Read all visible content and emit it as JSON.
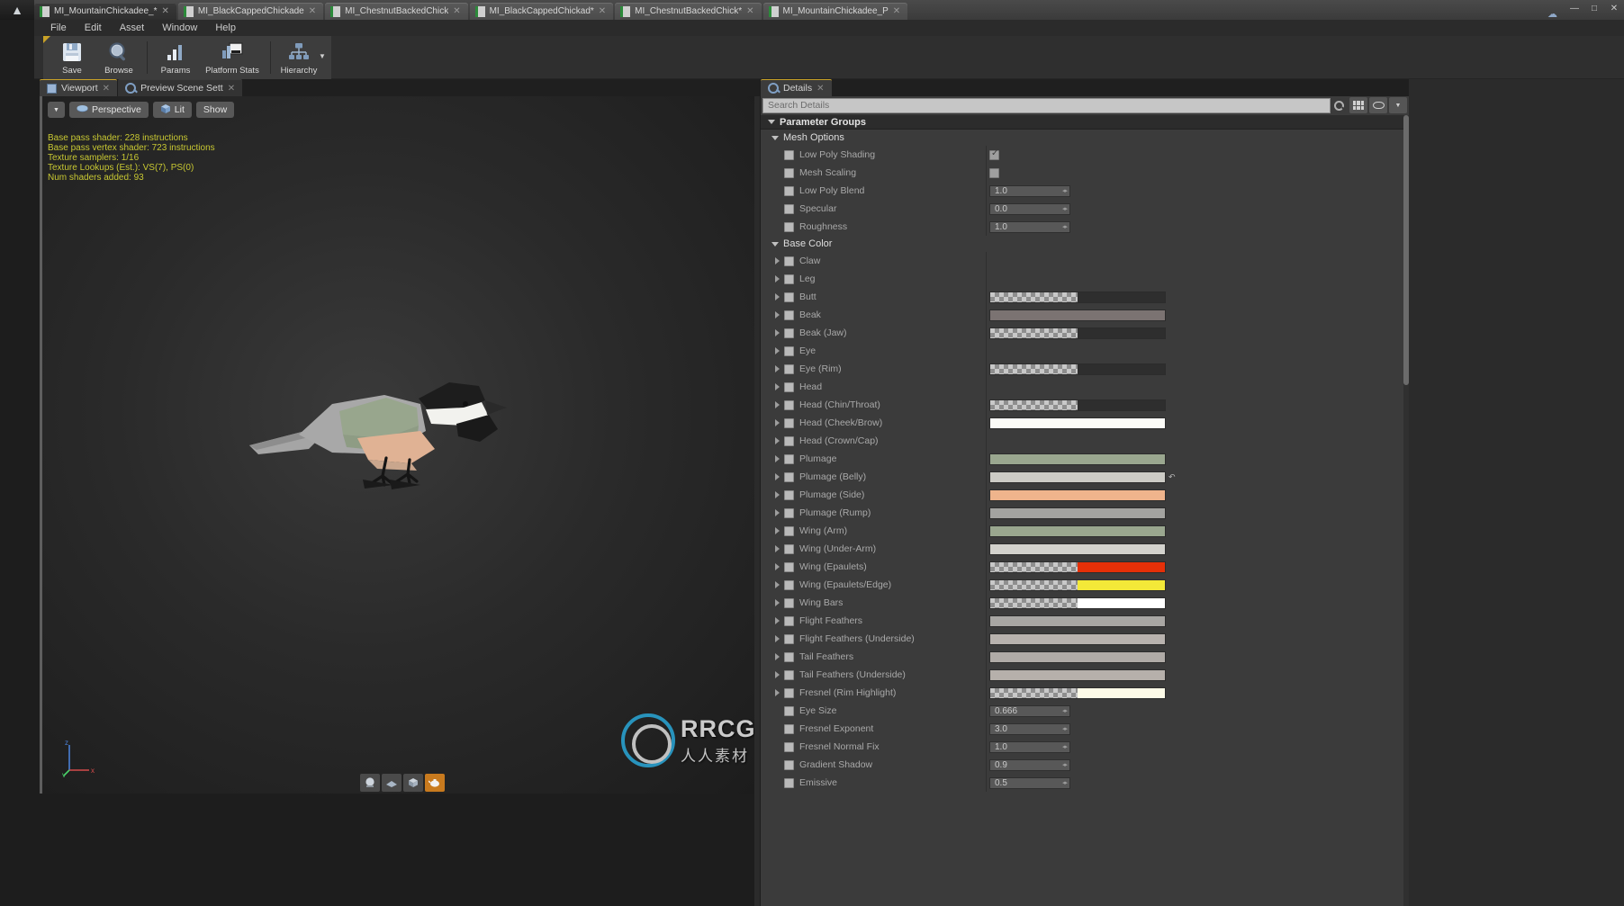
{
  "window": {
    "app_icon": "unreal-logo-icon",
    "cloud_icon": "cloud-sync-icon",
    "controls": [
      "minimize",
      "maximize",
      "close"
    ]
  },
  "tabs": [
    {
      "label": "MI_MountainChickadee_*",
      "active": true
    },
    {
      "label": "MI_BlackCappedChickade",
      "active": false
    },
    {
      "label": "MI_ChestnutBackedChick",
      "active": false
    },
    {
      "label": "MI_BlackCappedChickad*",
      "active": false
    },
    {
      "label": "MI_ChestnutBackedChick*",
      "active": false
    },
    {
      "label": "MI_MountainChickadee_P",
      "active": false
    }
  ],
  "menu": [
    "File",
    "Edit",
    "Asset",
    "Window",
    "Help"
  ],
  "toolbar": [
    {
      "label": "Save",
      "icon": "floppy-disk-icon"
    },
    {
      "label": "Browse",
      "icon": "magnifier-icon"
    },
    {
      "label": "Params",
      "icon": "bar-chart-icon"
    },
    {
      "label": "Platform Stats",
      "icon": "monitor-stats-icon"
    },
    {
      "label": "Hierarchy",
      "icon": "hierarchy-tree-icon"
    }
  ],
  "viewport_panel": {
    "tabs": [
      {
        "label": "Viewport",
        "icon": "viewport-grid-icon",
        "active": true
      },
      {
        "label": "Preview Scene Sett",
        "icon": "preview-scene-icon",
        "active": false
      }
    ],
    "toolbar": [
      {
        "label": "",
        "icon": "chevron-down-icon"
      },
      {
        "label": "Perspective",
        "icon": "camera-icon"
      },
      {
        "label": "Lit",
        "icon": "lit-cube-icon"
      },
      {
        "label": "Show",
        "icon": ""
      }
    ],
    "stats": [
      "Base pass shader: 228 instructions",
      "Base pass vertex shader: 723 instructions",
      "Texture samplers: 1/16",
      "Texture Lookups (Est.): VS(7), PS(0)",
      "Num shaders added: 93"
    ],
    "stats_color": "#c8c832",
    "axis_labels": [
      "z",
      "y",
      "x"
    ],
    "bottom_shapes": [
      "sphere-icon",
      "plane-icon",
      "cube-icon",
      "teapot-icon"
    ]
  },
  "watermark": {
    "main": "RRCG",
    "sub": "人人素材"
  },
  "details_panel": {
    "tab": {
      "label": "Details",
      "icon": "details-info-icon"
    },
    "search": {
      "placeholder": "Search Details",
      "value": ""
    },
    "buttons": [
      "grid-view-icon",
      "eye-visibility-icon"
    ],
    "group_title": "Parameter Groups",
    "sections": [
      {
        "title": "Mesh Options",
        "rows": [
          {
            "name": "Low Poly Shading",
            "type": "checkbox",
            "value": true,
            "expandable": false,
            "checked": false
          },
          {
            "name": "Mesh Scaling",
            "type": "checkbox",
            "value": false,
            "expandable": false,
            "checked": false
          },
          {
            "name": "Low Poly Blend",
            "type": "number",
            "value": "1.0",
            "expandable": false,
            "checked": false
          },
          {
            "name": "Specular",
            "type": "number",
            "value": "0.0",
            "expandable": false,
            "checked": false
          },
          {
            "name": "Roughness",
            "type": "number",
            "value": "1.0",
            "expandable": false,
            "checked": false
          }
        ]
      },
      {
        "title": "Base Color",
        "rows": [
          {
            "name": "Claw",
            "type": "none",
            "expandable": true
          },
          {
            "name": "Leg",
            "type": "none",
            "expandable": true
          },
          {
            "name": "Butt",
            "type": "color",
            "color": "#2e2e2e",
            "alpha": true,
            "expandable": true
          },
          {
            "name": "Beak",
            "type": "color",
            "color": "#7b7372",
            "alpha": false,
            "expandable": true
          },
          {
            "name": "Beak (Jaw)",
            "type": "color",
            "color": "#2e2e2e",
            "alpha": true,
            "expandable": true
          },
          {
            "name": "Eye",
            "type": "none",
            "expandable": true
          },
          {
            "name": "Eye (Rim)",
            "type": "color",
            "color": "#2e2e2e",
            "alpha": true,
            "expandable": true
          },
          {
            "name": "Head",
            "type": "none",
            "expandable": true
          },
          {
            "name": "Head (Chin/Throat)",
            "type": "color",
            "color": "#2e2e2e",
            "alpha": true,
            "expandable": true
          },
          {
            "name": "Head (Cheek/Brow)",
            "type": "color",
            "color": "#fbfbf7",
            "alpha": false,
            "expandable": true
          },
          {
            "name": "Head (Crown/Cap)",
            "type": "none",
            "expandable": true
          },
          {
            "name": "Plumage",
            "type": "color",
            "color": "#9aa78f",
            "alpha": false,
            "expandable": true
          },
          {
            "name": "Plumage (Belly)",
            "type": "color",
            "color": "#cccbc5",
            "alpha": false,
            "expandable": true,
            "revert": true
          },
          {
            "name": "Plumage (Side)",
            "type": "color",
            "color": "#efb48c",
            "alpha": false,
            "expandable": true
          },
          {
            "name": "Plumage (Rump)",
            "type": "color",
            "color": "#a3a3a0",
            "alpha": false,
            "expandable": true
          },
          {
            "name": "Wing (Arm)",
            "type": "color",
            "color": "#9aa78f",
            "alpha": false,
            "expandable": true
          },
          {
            "name": "Wing (Under-Arm)",
            "type": "color",
            "color": "#d3d2cd",
            "alpha": false,
            "expandable": true
          },
          {
            "name": "Wing (Epaulets)",
            "type": "color",
            "color": "#e53008",
            "alpha": true,
            "expandable": true
          },
          {
            "name": "Wing (Epaulets/Edge)",
            "type": "color",
            "color": "#f3e938",
            "alpha": true,
            "expandable": true
          },
          {
            "name": "Wing Bars",
            "type": "color",
            "color": "#ffffff",
            "alpha": true,
            "expandable": true
          },
          {
            "name": "Flight Feathers",
            "type": "color",
            "color": "#a8a6a3",
            "alpha": false,
            "expandable": true
          },
          {
            "name": "Flight Feathers (Underside)",
            "type": "color",
            "color": "#b8b2ae",
            "alpha": false,
            "expandable": true
          },
          {
            "name": "Tail Feathers",
            "type": "color",
            "color": "#b0aba7",
            "alpha": false,
            "expandable": true
          },
          {
            "name": "Tail Feathers (Underside)",
            "type": "color",
            "color": "#b6b0ab",
            "alpha": false,
            "expandable": true
          },
          {
            "name": "Fresnel (Rim Highlight)",
            "type": "color",
            "color": "#fdfbe8",
            "alpha": true,
            "expandable": true
          },
          {
            "name": "Eye Size",
            "type": "number",
            "value": "0.666",
            "expandable": false
          },
          {
            "name": "Fresnel Exponent",
            "type": "number",
            "value": "3.0",
            "expandable": false
          },
          {
            "name": "Fresnel Normal Fix",
            "type": "number",
            "value": "1.0",
            "expandable": false
          },
          {
            "name": "Gradient Shadow",
            "type": "number",
            "value": "0.9",
            "expandable": false
          },
          {
            "name": "Emissive",
            "type": "number",
            "value": "0.5",
            "expandable": false
          }
        ]
      }
    ]
  }
}
